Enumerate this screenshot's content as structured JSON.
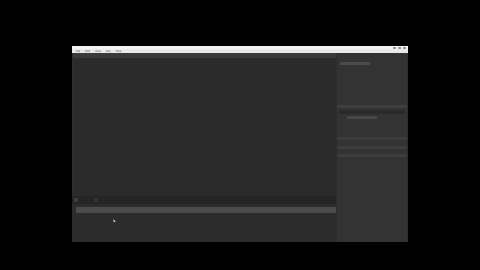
{
  "menu": [
    "File",
    "Edit",
    "View",
    "Clip",
    "Help"
  ],
  "right_panel": {
    "items": [
      "",
      "",
      "",
      "",
      ""
    ]
  },
  "timeline": {
    "start_time": "",
    "end_time": ""
  },
  "bottom_tabs": [
    "",
    ""
  ],
  "bottom_row": [
    "",
    "",
    "",
    ""
  ],
  "colors": {
    "accent": "#7e6fd6",
    "overlay_text": "#ff3a3a"
  }
}
